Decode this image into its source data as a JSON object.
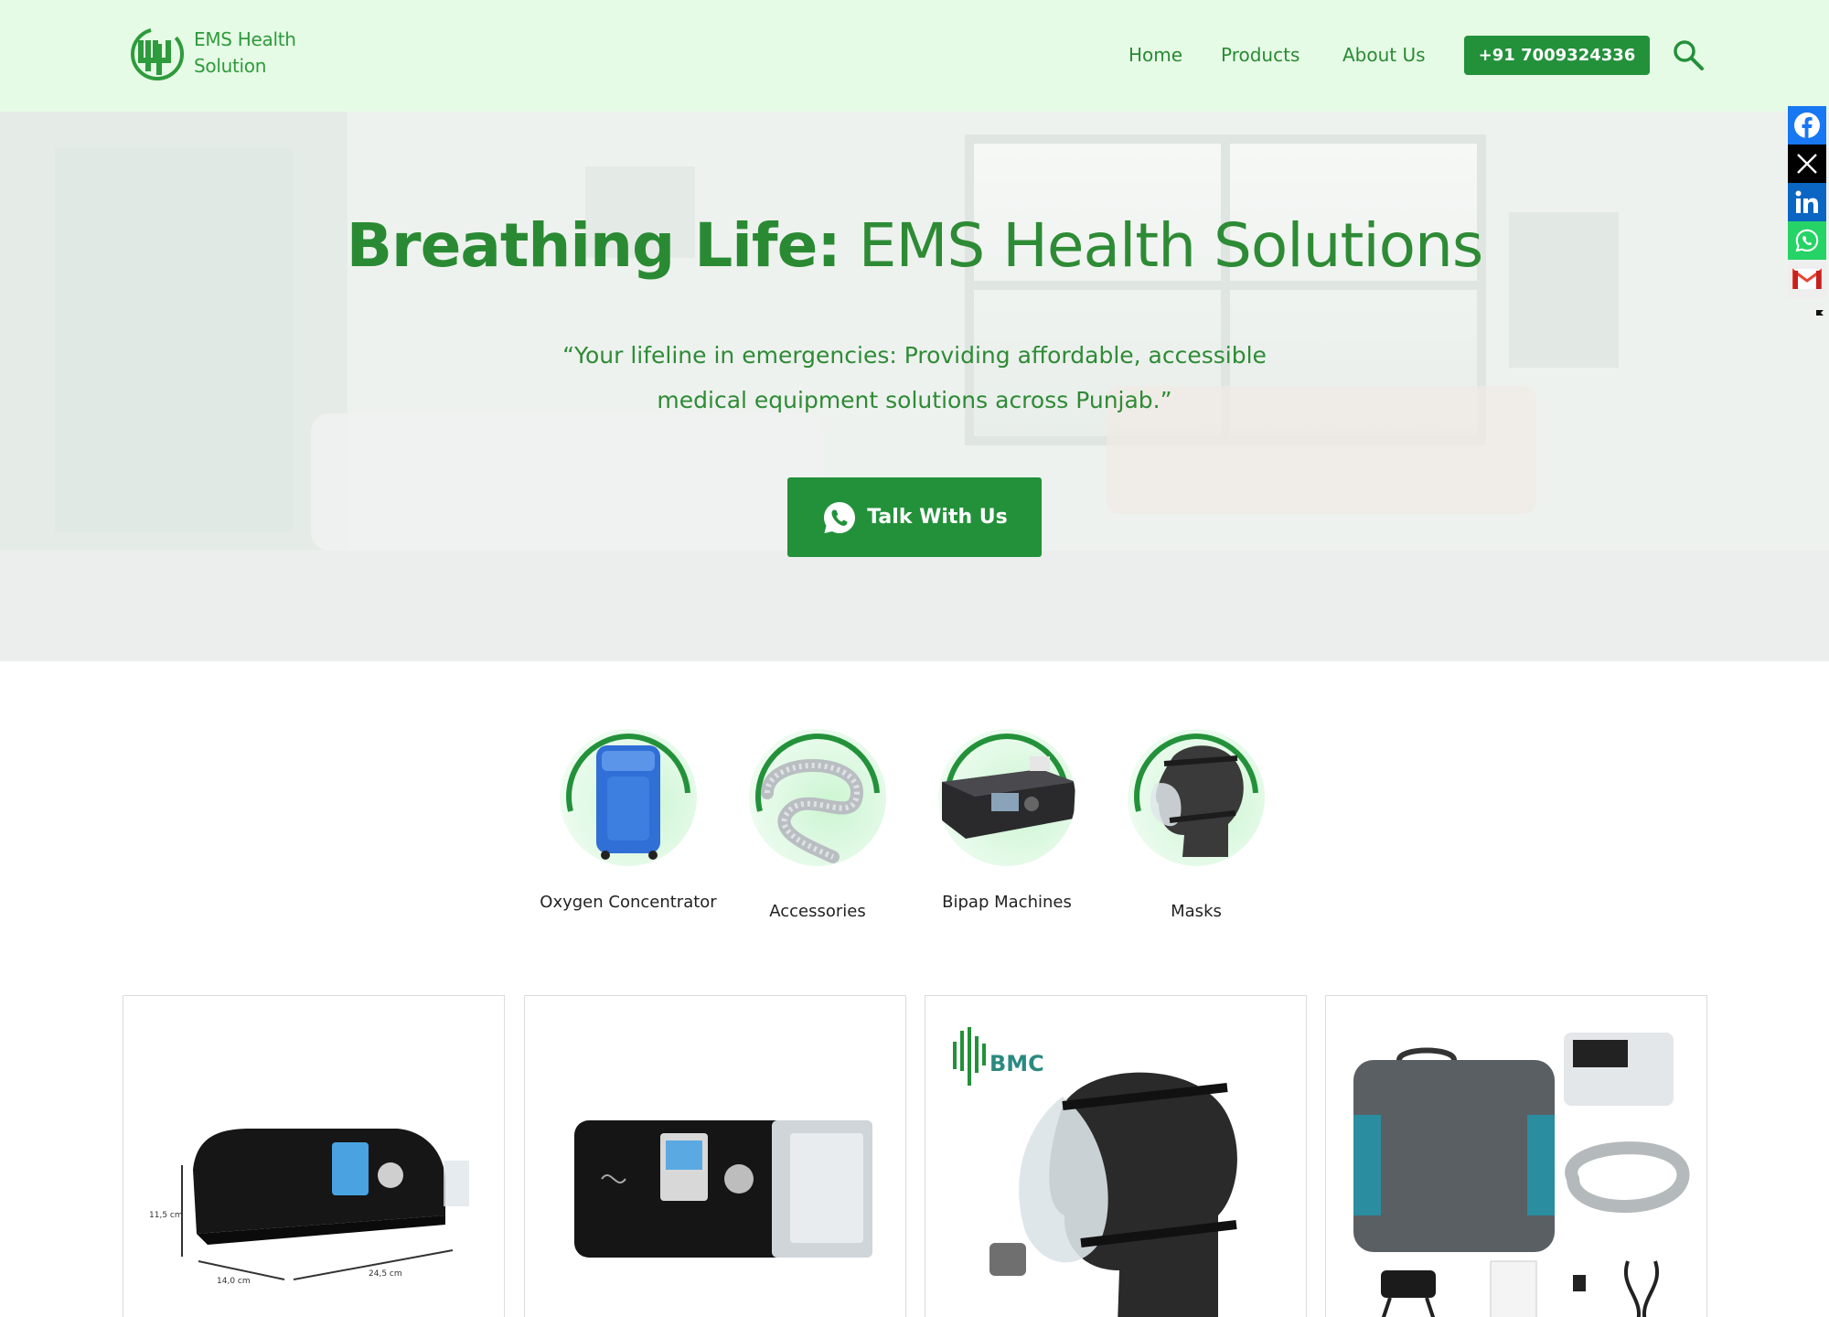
{
  "header": {
    "logo_line1": "EMS Health",
    "logo_line2": "Solution",
    "nav": [
      {
        "label": "Home"
      },
      {
        "label": "Products"
      },
      {
        "label": "About Us"
      }
    ],
    "phone_label": "+91 7009324336"
  },
  "hero": {
    "title_bold": "Breathing Life:",
    "title_rest": " EMS Health Solutions",
    "subtitle": "“Your lifeline in emergencies: Providing affordable, accessible medical equipment solutions across Punjab.”",
    "cta_label": "Talk With Us"
  },
  "social": [
    {
      "icon": "facebook-icon",
      "color": "#1877f2"
    },
    {
      "icon": "x-icon",
      "color": "#000000"
    },
    {
      "icon": "linkedin-icon",
      "color": "#0a66c2"
    },
    {
      "icon": "whatsapp-icon",
      "color": "#25d366"
    },
    {
      "icon": "gmail-icon",
      "color": "#ea4335"
    }
  ],
  "categories": [
    {
      "label": "Oxygen Concentrator"
    },
    {
      "label": "Accessories"
    },
    {
      "label": "Bipap Machines"
    },
    {
      "label": "Masks"
    }
  ],
  "cards": [
    {
      "dims": [
        "11,5 cm",
        "14,0 cm",
        "24,5 cm"
      ]
    },
    {},
    {
      "brand": "BMC"
    },
    {}
  ],
  "colors": {
    "brand_green": "#23913a",
    "header_bg": "#e6fbe6",
    "text_green": "#2e8b35"
  }
}
